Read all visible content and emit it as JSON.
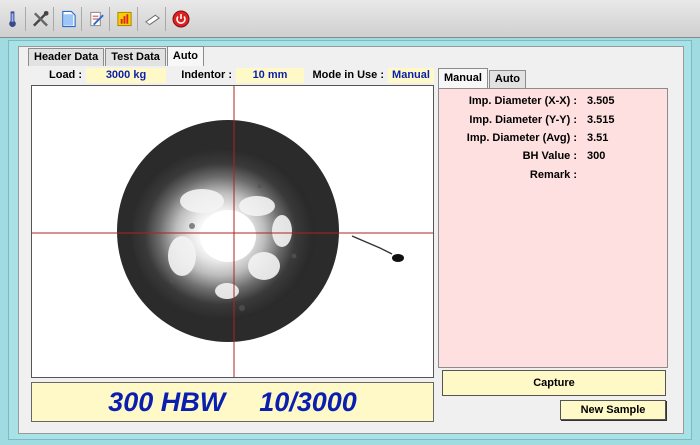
{
  "toolbar": {
    "icons": [
      "thermometer-icon",
      "tools-icon",
      "document-icon",
      "edit-document-icon",
      "report-icon",
      "eraser-icon",
      "power-icon"
    ]
  },
  "tabs_main": [
    {
      "label": "Header Data",
      "active": false
    },
    {
      "label": "Test Data",
      "active": false
    },
    {
      "label": "Auto",
      "active": true
    }
  ],
  "info": {
    "load_label": "Load :",
    "load_value": "3000 kg",
    "indentor_label": "Indentor :",
    "indentor_value": "10 mm",
    "mode_label": "Mode in Use :",
    "mode_value": "Manual"
  },
  "result": {
    "hardness": "300 HBW",
    "scale": "10/3000"
  },
  "tabs_measure": [
    {
      "label": "Manual",
      "active": true
    },
    {
      "label": "Auto",
      "active": false
    }
  ],
  "measurements": [
    {
      "label": "Imp. Diameter (X-X) :",
      "value": "3.505"
    },
    {
      "label": "Imp. Diameter (Y-Y) :",
      "value": "3.515"
    },
    {
      "label": "Imp. Diameter (Avg) :",
      "value": "3.51"
    },
    {
      "label": "BH Value :",
      "value": "300"
    },
    {
      "label": "Remark :",
      "value": ""
    }
  ],
  "buttons": {
    "capture": "Capture",
    "new_sample": "New Sample"
  },
  "colors": {
    "accent_text": "#0a1fb0",
    "highlight": "#fff9c8",
    "measure_bg": "#ffe0e0",
    "crosshair": "#b02020"
  }
}
